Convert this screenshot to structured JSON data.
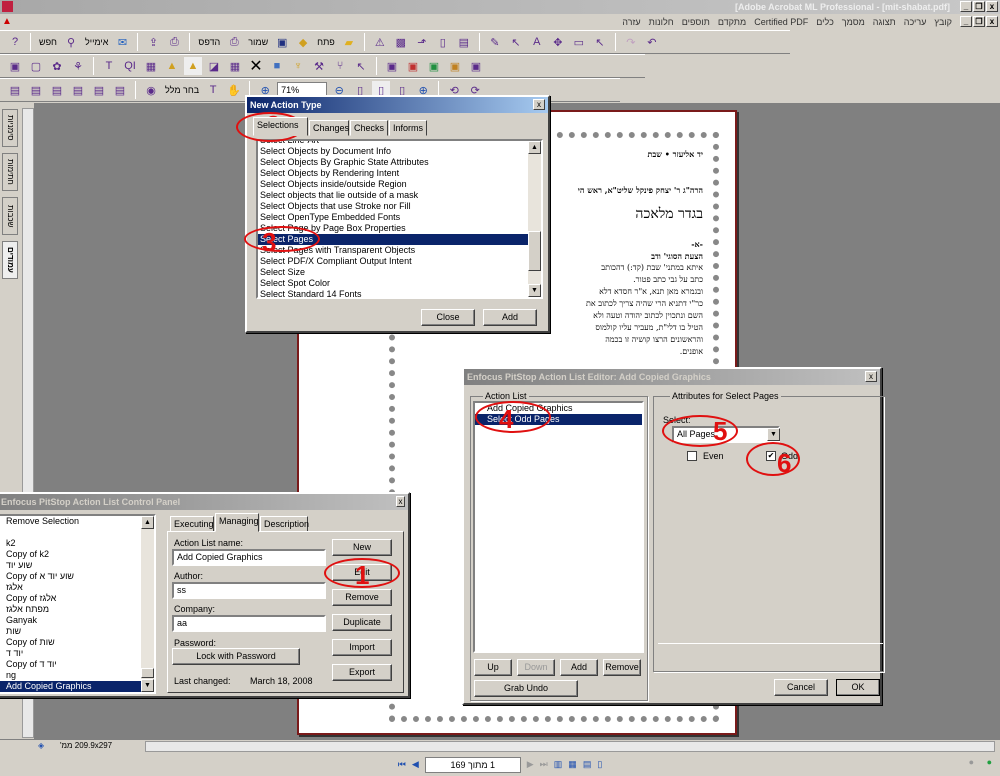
{
  "app": {
    "title": "[Adobe Acrobat ML Professional - [mit-shabat.pdf]",
    "menu": [
      "קובץ",
      "עריכה",
      "תצוגה",
      "מסמך",
      "כלים",
      "Certified PDF",
      "מתקדם",
      "תוספים",
      "חלונות",
      "עזרה"
    ],
    "toolbar": {
      "open": "פתח",
      "save": "שמור",
      "print": "הדפס",
      "email": "אימייל",
      "search": "חפש",
      "select_text": "בחר מלל",
      "zoom": "71%"
    },
    "nav_tabs": [
      "סימניות",
      "חתימות",
      "שכבות",
      "עמודים"
    ],
    "status": {
      "page_size": "209.9x297 ממ'",
      "page_field": "1 מתוך 169"
    }
  },
  "page_text": {
    "header": "יד אליעזר • שבת",
    "author": "הרה\"ג ר' יצחק פינקל שליט\"א, ראש הי",
    "title": "בגדר מלאכה",
    "section": "-א-",
    "subtitle": "הצעת הסוגי' ודב",
    "body": [
      "איתא במתני' שבת (קד:) דהכותב",
      "כתב על גבי כתב פטור.",
      "ובגמרא מאן תנא, א\"ר חסדא דלא",
      "כר\"י דתניא הרי שהיה צריך לכתוב את",
      "השם ונתכוין לכתוב יהודה וטעה ולא",
      "הטיל בו דלי\"ת, מעביר עליו קולמוס",
      "והראשונים הרצו קושיה זו בכמה",
      "אופנים."
    ]
  },
  "new_action_type": {
    "title": "New Action Type",
    "tabs": [
      "Selections",
      "Changes",
      "Checks",
      "Informs"
    ],
    "items": [
      "Select Line-Art",
      "Select Objects by Document Info",
      "Select Objects By Graphic State Attributes",
      "Select Objects by Rendering Intent",
      "Select Objects inside/outside Region",
      "Select objects that lie outside of a mask",
      "Select Objects that use Stroke nor Fill",
      "Select OpenType Embedded Fonts",
      "Select Page by Page Box Properties",
      "Select Pages",
      "Select Pages with Transparent Objects",
      "Select PDF/X Compliant Output Intent",
      "Select Size",
      "Select Spot Color",
      "Select Standard 14 Fonts"
    ],
    "selected_index": 9,
    "close": "Close",
    "add": "Add"
  },
  "control_panel": {
    "title": "Enfocus PitStop Action List Control Panel",
    "lists": [
      "Remove Selection",
      "",
      "k2",
      "Copy of k2",
      "שוע יוד",
      "Copy of שוע יוד א",
      "אלגז",
      "Copy of אלגז",
      "מפתח אלגז",
      "Ganyak",
      "שות",
      "Copy of שות",
      "יוד ד",
      "Copy of יוד ד",
      "ng",
      "Add Copied Graphics"
    ],
    "selected_index": 15,
    "tabs": [
      "Executing",
      "Managing",
      "Description"
    ],
    "name_label": "Action List name:",
    "name_value": "Add Copied Graphics",
    "author_label": "Author:",
    "author_value": "ss",
    "company_label": "Company:",
    "company_value": "aa",
    "password_label": "Password:",
    "lock": "Lock with Password",
    "last_changed_label": "Last changed:",
    "last_changed_value": "March 18, 2008",
    "buttons": {
      "new": "New",
      "edit": "Edit",
      "remove": "Remove",
      "duplicate": "Duplicate",
      "import": "Import",
      "export": "Export"
    }
  },
  "editor": {
    "title": "Enfocus PitStop Action List Editor: Add Copied Graphics",
    "action_list_label": "Action List",
    "actions": [
      "Add Copied Graphics",
      "Select Odd Pages"
    ],
    "selected_index": 1,
    "attributes_label": "Attributes for Select Pages",
    "select_label": "Select:",
    "select_value": "All Pages",
    "even_label": "Even",
    "even_checked": false,
    "odd_label": "Odd",
    "odd_checked": true,
    "buttons": {
      "up": "Up",
      "down": "Down",
      "add": "Add",
      "remove": "Remove",
      "grab_undo": "Grab Undo",
      "cancel": "Cancel",
      "ok": "OK"
    }
  },
  "annotations": [
    "1",
    "2",
    "3",
    "4",
    "5",
    "6"
  ],
  "colors": {
    "selection": "#0a246a",
    "annotation": "#e01010",
    "page_border": "#7a1a1a"
  }
}
